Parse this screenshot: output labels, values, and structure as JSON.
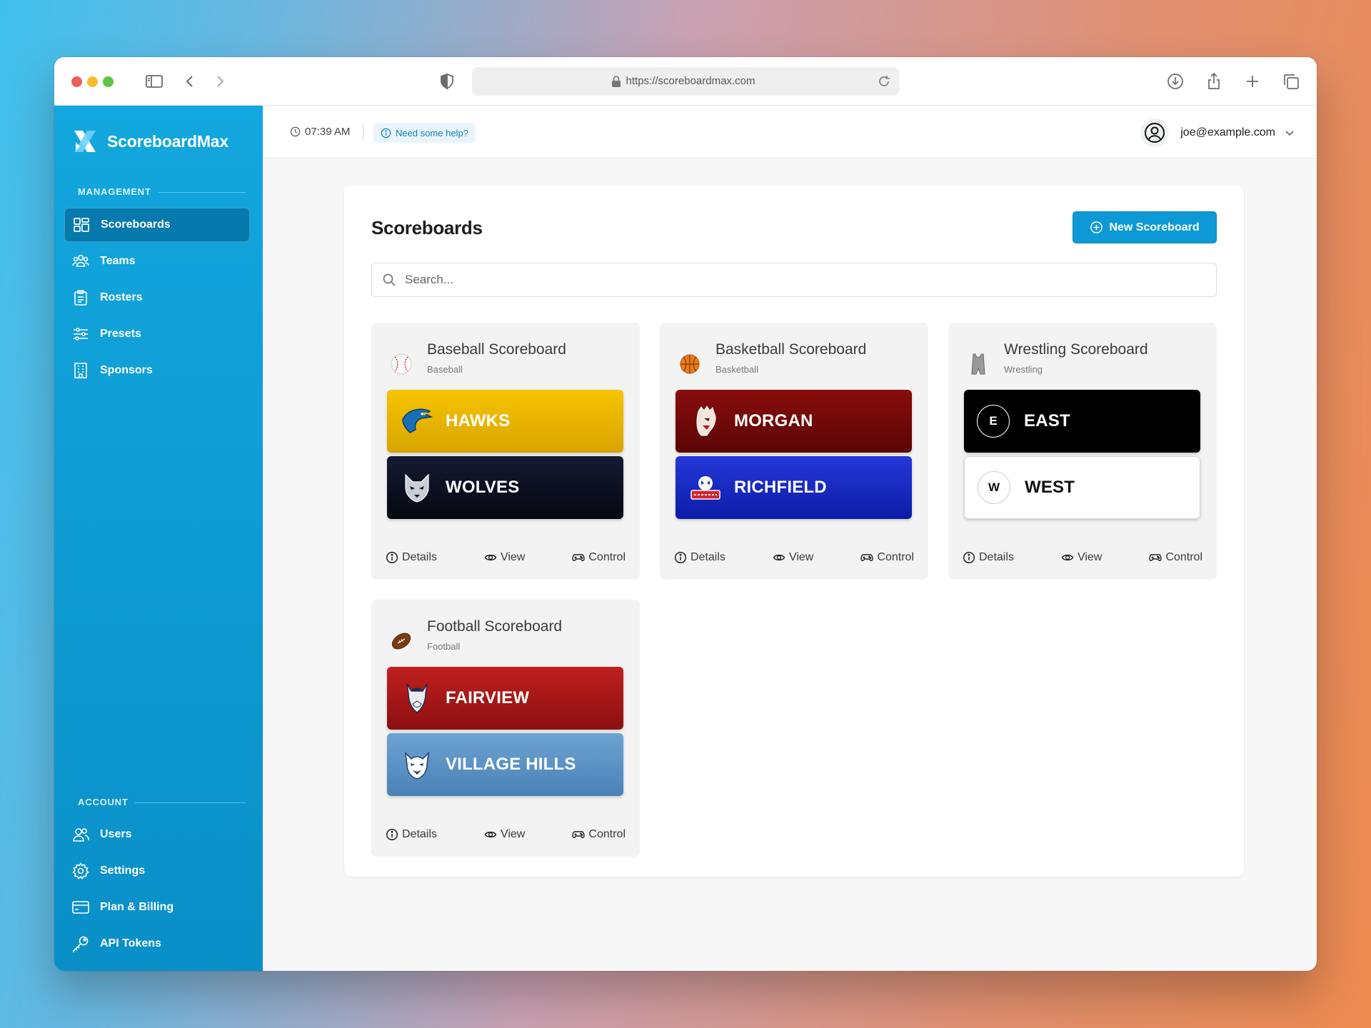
{
  "browser": {
    "url": "https://scoreboardmax.com"
  },
  "app": {
    "brand_name": "ScoreboardMax",
    "time": "07:39 AM",
    "help_label": "Need some help?",
    "user_email": "joe@example.com",
    "accent_color": "#0d99d6"
  },
  "sidebar": {
    "management_label": "MANAGEMENT",
    "management_items": [
      {
        "label": "Scoreboards",
        "icon": "dashboard-icon",
        "active": true
      },
      {
        "label": "Teams",
        "icon": "users-group-icon"
      },
      {
        "label": "Rosters",
        "icon": "clipboard-icon"
      },
      {
        "label": "Presets",
        "icon": "sliders-icon"
      },
      {
        "label": "Sponsors",
        "icon": "building-icon"
      }
    ],
    "account_label": "ACCOUNT",
    "account_items": [
      {
        "label": "Users",
        "icon": "users-icon"
      },
      {
        "label": "Settings",
        "icon": "gear-icon"
      },
      {
        "label": "Plan & Billing",
        "icon": "credit-card-icon"
      },
      {
        "label": "API Tokens",
        "icon": "key-icon"
      }
    ]
  },
  "main": {
    "title": "Scoreboards",
    "new_button_label": "New Scoreboard",
    "search_placeholder": "Search...",
    "action_labels": {
      "details": "Details",
      "view": "View",
      "control": "Control"
    },
    "scoreboards": [
      {
        "title": "Baseball Scoreboard",
        "sport": "Baseball",
        "teams": [
          {
            "name": "HAWKS",
            "color": "#e8b200",
            "logo": "hawk-icon"
          },
          {
            "name": "WOLVES",
            "color": "#0b0f1e",
            "logo": "wolf-icon"
          }
        ]
      },
      {
        "title": "Basketball Scoreboard",
        "sport": "Basketball",
        "teams": [
          {
            "name": "MORGAN",
            "color": "#7a0a0a",
            "logo": "warrior-icon"
          },
          {
            "name": "RICHFIELD",
            "color": "#1a2fc4",
            "logo": "richfield-icon"
          }
        ]
      },
      {
        "title": "Wrestling Scoreboard",
        "sport": "Wrestling",
        "teams": [
          {
            "name": "EAST",
            "letter": "E",
            "color": "#000000"
          },
          {
            "name": "WEST",
            "letter": "W",
            "color": "#ffffff"
          }
        ]
      },
      {
        "title": "Football Scoreboard",
        "sport": "Football",
        "teams": [
          {
            "name": "FAIRVIEW",
            "color": "#b0181a",
            "logo": "viking-icon"
          },
          {
            "name": "VILLAGE HILLS",
            "color": "#5a93c4",
            "logo": "wildcat-icon"
          }
        ]
      }
    ]
  }
}
